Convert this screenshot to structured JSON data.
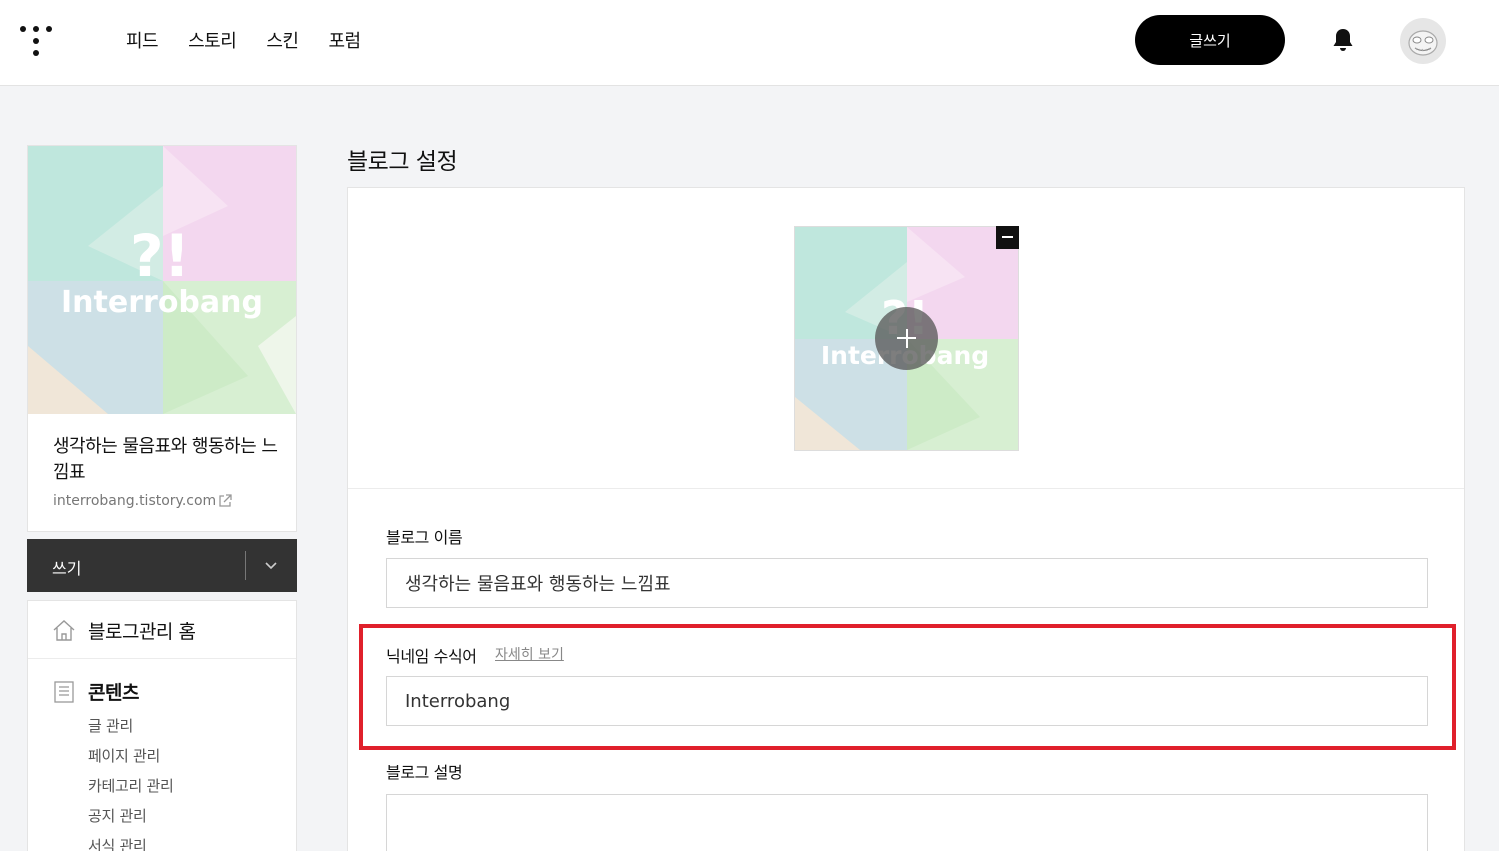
{
  "header": {
    "nav": [
      "피드",
      "스토리",
      "스킨",
      "포럼"
    ],
    "write_button": "글쓰기",
    "accent_color": "#000000"
  },
  "sidebar": {
    "cover_text": "Interrobang",
    "blog_title": "생각하는 물음표와 행동하는 느낌표",
    "blog_url": "interrobang.tistory.com",
    "write_label": "쓰기",
    "home_label": "블로그관리 홈",
    "content_label": "콘텐츠",
    "content_items": [
      "글 관리",
      "페이지 관리",
      "카테고리 관리",
      "공지 관리",
      "서식 관리"
    ]
  },
  "main": {
    "page_title": "블로그 설정",
    "image_text": "Interrobang",
    "fields": {
      "blog_name": {
        "label": "블로그 이름",
        "value": "생각하는 물음표와 행동하는 느낌표"
      },
      "nickname": {
        "label": "닉네임 수식어",
        "link": "자세히 보기",
        "value": "Interrobang"
      },
      "description": {
        "label": "블로그 설명",
        "value": ""
      }
    },
    "highlight_color": "#e0202b"
  }
}
